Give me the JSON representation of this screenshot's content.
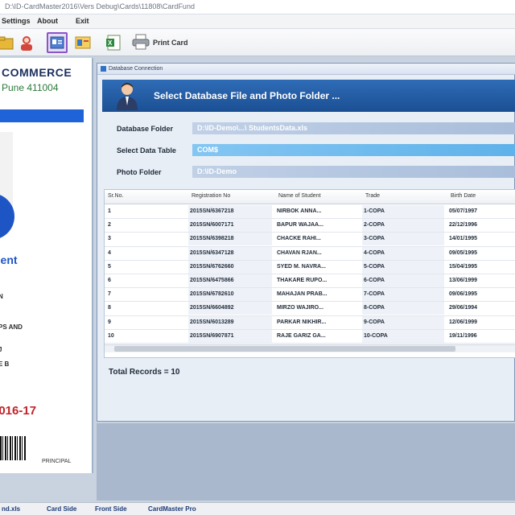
{
  "window": {
    "title": "D:\\ID-CardMaster2016\\Vers Debug\\Cards\\11808\\CardFund"
  },
  "menu": [
    "Settings",
    "About",
    "Exit"
  ],
  "toolbar": {
    "print_label": "Print Card"
  },
  "card": {
    "org": "COMMERCE",
    "city": "Pune 411004",
    "role": "dent",
    "lines": [
      "N",
      "PS AND",
      "J",
      "E B"
    ],
    "year": "2016-17",
    "signature": "PRINCIPAL"
  },
  "dialog": {
    "caption": "Database Connection",
    "banner_title": "Select Database File and Photo Folder ...",
    "fields": [
      {
        "label": "Database Folder",
        "value": "D:\\ID-Demo\\...\\ StudentsData.xls"
      },
      {
        "label": "Select Data Table",
        "value": "COM$"
      },
      {
        "label": "Photo Folder",
        "value": "D:\\ID-Demo"
      }
    ],
    "columns": [
      "Sr.No.",
      "Registration No",
      "Name of Student",
      "Trade",
      "Birth Date"
    ],
    "rows": [
      [
        "1",
        "2015SN/6367218",
        "NIRBOK ANNA...",
        "1-COPA",
        "05/07/1997"
      ],
      [
        "2",
        "2015SN/6007171",
        "BAPUR WAJAA...",
        "2-COPA",
        "22/12/1996"
      ],
      [
        "3",
        "2015SN/6398218",
        "CHACKE RAHI...",
        "3-COPA",
        "14/01/1995"
      ],
      [
        "4",
        "2015SN/6347128",
        "CHAVAN RJAN...",
        "4-COPA",
        "09/05/1995"
      ],
      [
        "5",
        "2015SN/6762660",
        "SYED M. NAVRA...",
        "5-COPA",
        "15/04/1995"
      ],
      [
        "6",
        "2015SN/6475866",
        "THAKARE RUPO...",
        "6-COPA",
        "13/06/1999"
      ],
      [
        "7",
        "2015SN/6782610",
        "MAHAJAN PRAB...",
        "7-COPA",
        "09/06/1995"
      ],
      [
        "8",
        "2015SN/6604892",
        "MIRZO WAJIRO...",
        "8-COPA",
        "29/06/1994"
      ],
      [
        "9",
        "2015SN/6013289",
        "PARKAR NIKHIR...",
        "9-COPA",
        "12/06/1999"
      ],
      [
        "10",
        "2015SN/6907871",
        "RAJE GARIZ GA...",
        "10-COPA",
        "19/11/1996"
      ]
    ],
    "total_label": "Total Records = 10"
  },
  "status": [
    "nd.xls",
    "Card Side",
    "Front Side",
    "CardMaster Pro"
  ],
  "colors": {
    "banner": "#1b4f93",
    "accent": "#1e64d8",
    "year": "#c2232a"
  }
}
